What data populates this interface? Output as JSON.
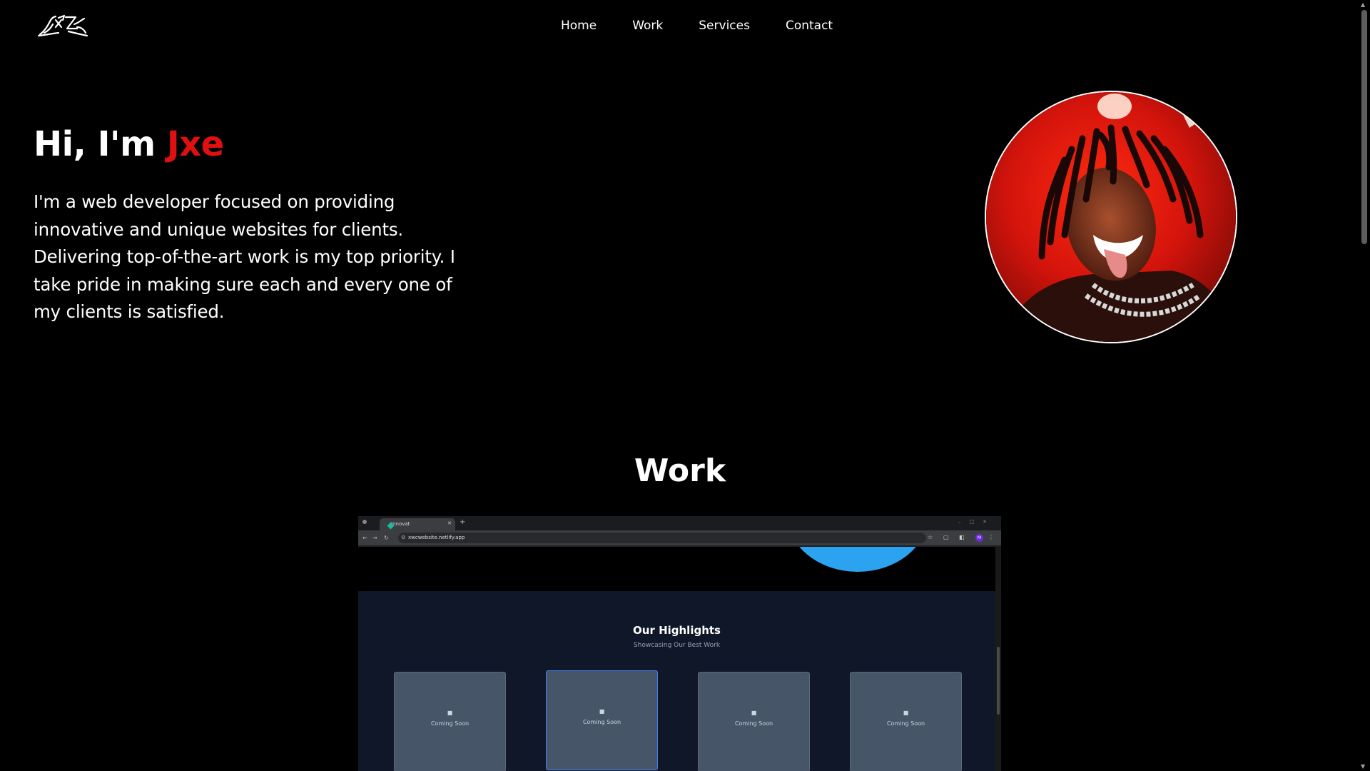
{
  "nav": {
    "items": [
      "Home",
      "Work",
      "Services",
      "Contact"
    ]
  },
  "hero": {
    "greeting": "Hi, I'm ",
    "name": "Jxe",
    "description": "I'm a web developer focused on providing innovative and unique websites for clients. Delivering top-of-the-art work is my top priority. I take pride in making sure each and every one of my clients is satisfied.",
    "accent_color": "#e01010"
  },
  "work": {
    "title": "Work"
  },
  "browser": {
    "tab_title": "Innovat",
    "url": "xwcwebsite.netlify.app",
    "profile_initial": "M",
    "page": {
      "highlights_title": "Our Highlights",
      "highlights_subtitle": "Showcasing Our Best Work",
      "cards": [
        {
          "label": "Coming Soon"
        },
        {
          "label": "Coming Soon"
        },
        {
          "label": "Coming Soon"
        },
        {
          "label": "Coming Soon"
        }
      ]
    }
  },
  "icons": {
    "logo": "logo-mark",
    "card_icon": "camera-icon"
  }
}
